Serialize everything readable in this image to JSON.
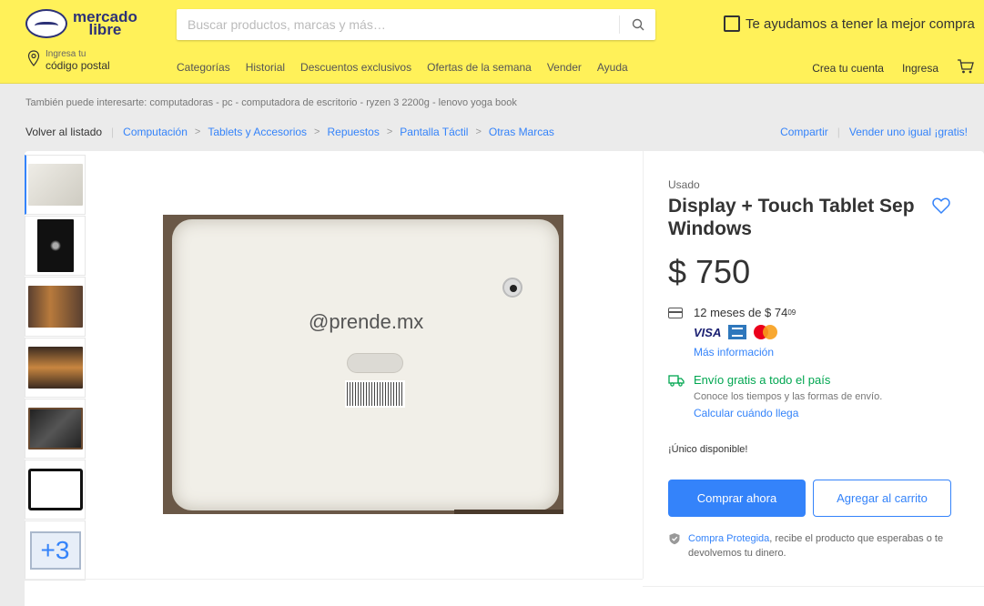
{
  "header": {
    "logo_line1": "mercado",
    "logo_line2": "libre",
    "search_placeholder": "Buscar productos, marcas y más…",
    "promo_text": "Te ayudamos a tener la mejor compra",
    "location_small": "Ingresa tu",
    "location_big": "código postal",
    "nav": [
      "Categorías",
      "Historial",
      "Descuentos exclusivos",
      "Ofertas de la semana",
      "Vender",
      "Ayuda"
    ],
    "account": [
      "Crea tu cuenta",
      "Ingresa"
    ]
  },
  "related_text": "También puede interesarte: computadoras - pc - computadora de escritorio - ryzen 3 2200g - lenovo yoga book",
  "breadcrumb": {
    "back": "Volver al listado",
    "items": [
      "Computación",
      "Tablets y Accesorios",
      "Repuestos",
      "Pantalla Táctil",
      "Otras Marcas"
    ]
  },
  "share_actions": [
    "Compartir",
    "Vender uno igual ¡gratis!"
  ],
  "gallery": {
    "more_label": "+3",
    "watermark": "@prende.mx"
  },
  "product": {
    "condition": "Usado",
    "title": "Display + Touch Tablet Sep Windows",
    "price": "$ 750",
    "installments_prefix": "12 meses de $ 74",
    "installments_cents": "09",
    "visa_label": "VISA",
    "more_info": "Más información",
    "shipping_title": "Envío gratis a todo el país",
    "shipping_sub": "Conoce los tiempos y las formas de envío.",
    "shipping_calc": "Calcular cuándo llega",
    "stock": "¡Único disponible!",
    "buy_now": "Comprar ahora",
    "add_cart": "Agregar al carrito",
    "protect_link": "Compra Protegida",
    "protect_text": ", recibe el producto que esperabas o te devolvemos tu dinero."
  },
  "colors": {
    "header_bg": "#fff159",
    "accent_blue": "#3483fa",
    "shipping_green": "#00a650"
  }
}
